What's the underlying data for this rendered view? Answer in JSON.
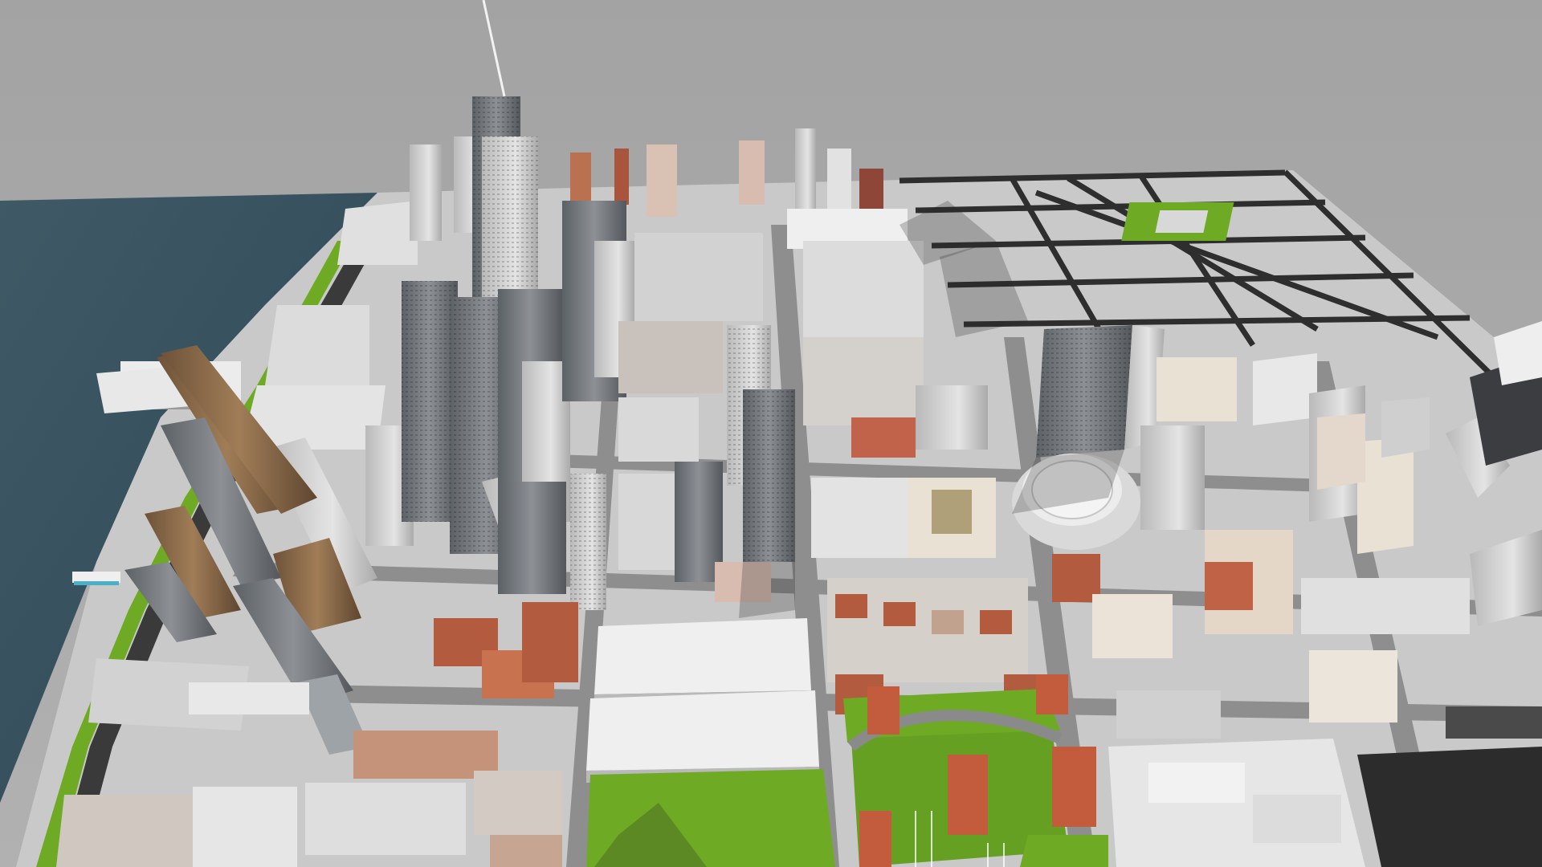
{
  "scene": {
    "description_free": true,
    "colors": {
      "sky": "#a7a7a7",
      "water_deep": "#37505d",
      "water_shallow": "#4d6a78",
      "ground": "#cfcfcf",
      "street": "#3a3a3a",
      "street_light": "#8c8c8c",
      "grass": "#6faa24",
      "grass_dark": "#4e8a18",
      "tower_glass": "#6d7175",
      "tower_light": "#d8d8d8",
      "tower_gold": "#8b6a48",
      "brick": "#b0583c",
      "roof": "#eeeeee",
      "shadow": "#2f2f2f"
    },
    "icons": [
      "arena-dome",
      "antenna-spire",
      "pier"
    ]
  }
}
